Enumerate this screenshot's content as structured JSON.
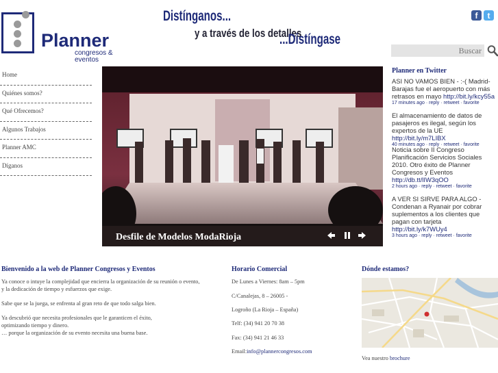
{
  "header": {
    "logo_word": "Planner",
    "logo_sub": "congresos & eventos",
    "slogan_1": "Distínganos...",
    "slogan_2": "y a través de los detalles",
    "slogan_3": "...Distíngase",
    "social": [
      {
        "label": "f",
        "icon": "facebook-icon",
        "color": "#3b5998"
      },
      {
        "label": "t",
        "icon": "twitter-icon",
        "color": "#55acee"
      }
    ],
    "search_placeholder": "Buscar"
  },
  "nav": {
    "items": [
      {
        "label": "Home"
      },
      {
        "label": "Quiénes somos?"
      },
      {
        "label": "Qué Ofrecemos?"
      },
      {
        "label": "Algunos Trabajos"
      },
      {
        "label": "Planner AMC"
      },
      {
        "label": "Díganos"
      }
    ]
  },
  "slideshow": {
    "caption": "Desfile de Modelos ModaRioja",
    "controls": [
      "prev-icon",
      "pause-icon",
      "next-icon"
    ]
  },
  "twitter": {
    "title": "Planner en Twitter",
    "actions": [
      "reply",
      "retweet",
      "favorite"
    ],
    "tweets": [
      {
        "text": "ASI NO VAMOS BIEN - :-( Madrid-Barajas fue el aeropuerto con más retrasos en mayo ",
        "link": "http://bit.ly/kcy55a",
        "time": "17 minutes ago"
      },
      {
        "text": "El almacenamiento de datos de pasajeros es ilegal, según los expertos de la UE ",
        "link": "http://bit.ly/m7LIBX",
        "time": "40 minutes ago"
      },
      {
        "text": "Noticia sobre II Congreso Planificación Servicios Sociales 2010. Otro éxito de Planner Congresos y Eventos ",
        "link": "http://db.tt/lIW3qOO",
        "time": "2 hours ago"
      },
      {
        "text": "A VER SI SIRVE PARA ALGO - Condenan a Ryanair por cobrar suplementos a los clientes que pagan con tarjeta ",
        "link": "http://bit.ly/k7WUy4",
        "time": "3 hours ago"
      }
    ]
  },
  "welcome": {
    "title": "Bienvenido a la web de Planner Congresos y Eventos",
    "p1": "Ya conoce o intuye la complejidad que encierra la organización de su reunión o evento, y la dedicación de tiempo y esfuerzos que exige.",
    "p2": "Sabe que se la juega, se enfrenta al gran reto de que todo salga bien.",
    "p3a": "Ya descubrió que necesita profesionales que le garanticen el éxito, optimizando tiempo y dinero.",
    "p3b": "… porque la organización de su evento necesita una buena base."
  },
  "contact": {
    "title": "Horario Comercial",
    "hours": "De Lunes a Viernes: 8am – 5pm",
    "street": "C/Canalejas, 8 – 26005 -",
    "city": "Logroño (La Rioja – España)",
    "tel": "Telf: (34) 941 20 70 38",
    "fax": "Fax: (34) 941 21 46 33",
    "email_label": "Email:",
    "email": "info@plannercongresos.com"
  },
  "location": {
    "title": "Dónde estamos?",
    "brochure_prefix": "Vea nuestro ",
    "brochure_link": "brochure"
  }
}
